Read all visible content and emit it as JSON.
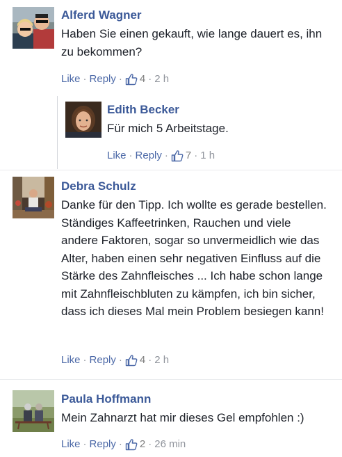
{
  "comments": [
    {
      "author": "Alferd Wagner",
      "text": "Haben Sie einen gekauft, wie lange dauert es, ihn zu bekommen?",
      "like_label": "Like",
      "reply_label": "Reply",
      "likes": "4",
      "time": "2 h"
    },
    {
      "author": "Edith Becker",
      "text": "Für mich 5 Arbeitstage.",
      "like_label": "Like",
      "reply_label": "Reply",
      "likes": "7",
      "time": "1 h"
    },
    {
      "author": "Debra Schulz",
      "text": "Danke für den Tipp. Ich wollte es gerade bestellen. Ständiges Kaffeetrinken, Rauchen und viele andere Faktoren, sogar so unvermeidlich wie das Alter, haben einen sehr negativen Einfluss auf die Stärke des Zahnfleisches ... Ich habe schon lange mit Zahnfleischbluten zu kämpfen, ich bin sicher, dass ich dieses Mal mein Problem besiegen kann!",
      "like_label": "Like",
      "reply_label": "Reply",
      "likes": "4",
      "time": "2 h"
    },
    {
      "author": "Paula Hoffmann",
      "text": "Mein Zahnarzt hat mir dieses Gel empfohlen :)",
      "like_label": "Like",
      "reply_label": "Reply",
      "likes": "2",
      "time": "26 min"
    }
  ],
  "colors": {
    "author": "#3b5998",
    "link": "#4b68a7",
    "meta": "#90949c",
    "text": "#1d2129"
  },
  "icons": {
    "like": "thumbs-up-outline-icon"
  }
}
